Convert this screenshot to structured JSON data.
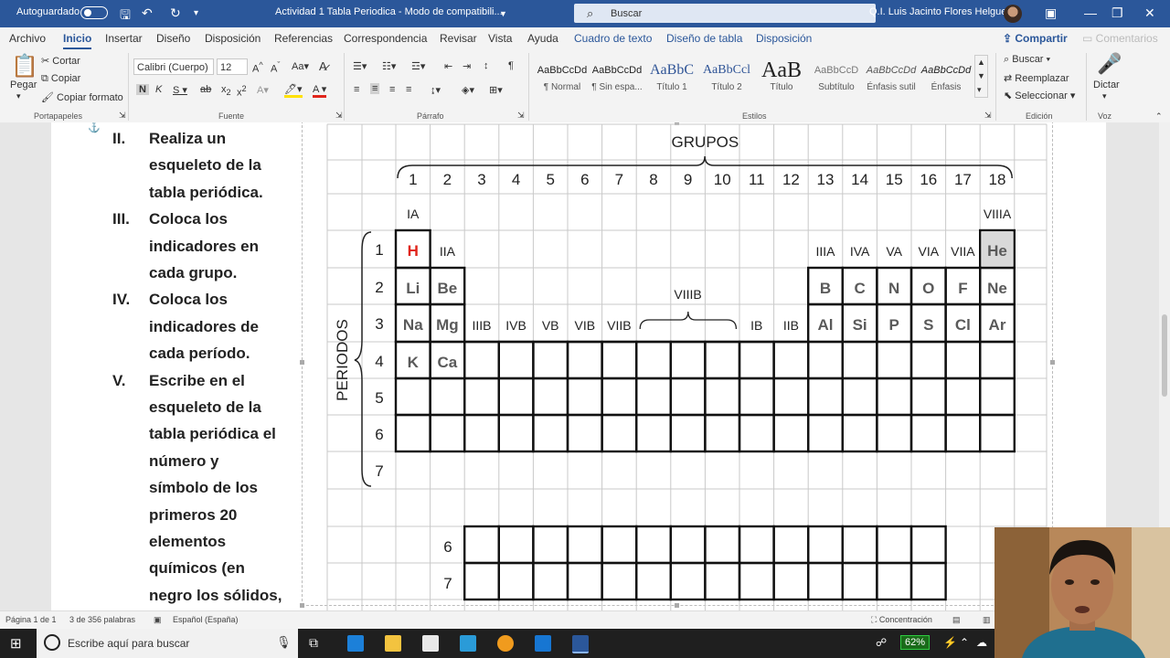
{
  "titlebar": {
    "autosave": "Autoguardado",
    "doc_title": "Actividad 1 Tabla Periodica  -  Modo de compatibili...",
    "search_placeholder": "Buscar",
    "user": "Q.I. Luis Jacinto Flores Helguera"
  },
  "tabs": [
    "Archivo",
    "Inicio",
    "Insertar",
    "Diseño",
    "Disposición",
    "Referencias",
    "Correspondencia",
    "Revisar",
    "Vista",
    "Ayuda",
    "Cuadro de texto",
    "Diseño de tabla",
    "Disposición"
  ],
  "share": {
    "label": "Compartir",
    "comments": "Comentarios"
  },
  "ribbon": {
    "clipboard": {
      "paste": "Pegar",
      "cut": "Cortar",
      "copy": "Copiar",
      "format_painter": "Copiar formato",
      "label": "Portapapeles"
    },
    "font": {
      "name": "Calibri (Cuerpo)",
      "size": "12",
      "label": "Fuente"
    },
    "paragraph": {
      "label": "Párrafo"
    },
    "styles": {
      "label": "Estilos",
      "items": [
        {
          "preview": "AaBbCcDd",
          "name": "¶ Normal"
        },
        {
          "preview": "AaBbCcDd",
          "name": "¶ Sin espa..."
        },
        {
          "preview": "AaBbC",
          "name": "Título 1"
        },
        {
          "preview": "AaBbCcl",
          "name": "Título 2"
        },
        {
          "preview": "AaB",
          "name": "Título"
        },
        {
          "preview": "AaBbCcD",
          "name": "Subtítulo"
        },
        {
          "preview": "AaBbCcDd",
          "name": "Énfasis sutil"
        },
        {
          "preview": "AaBbCcDd",
          "name": "Énfasis"
        }
      ]
    },
    "editing": {
      "find": "Buscar",
      "replace": "Reemplazar",
      "select": "Seleccionar",
      "label": "Edición"
    },
    "voice": {
      "dictate": "Dictar",
      "label": "Voz"
    }
  },
  "doc": {
    "list": [
      {
        "num": "II.",
        "lines": [
          "Realiza un",
          "esqueleto de la",
          "tabla periódica."
        ]
      },
      {
        "num": "III.",
        "lines": [
          "Coloca los",
          "indicadores en",
          "cada grupo."
        ]
      },
      {
        "num": "IV.",
        "lines": [
          "Coloca los",
          "indicadores de",
          "cada período."
        ]
      },
      {
        "num": "V.",
        "lines": [
          "Escribe en el",
          "esqueleto de la",
          "tabla periódica el",
          "número y",
          "símbolo de los",
          "primeros 20",
          "elementos",
          "químicos (en",
          "negro los sólidos,"
        ]
      }
    ],
    "table": {
      "grupos": "GRUPOS",
      "periodos": "PERIODOS",
      "group_numbers": [
        "1",
        "2",
        "3",
        "4",
        "5",
        "6",
        "7",
        "8",
        "9",
        "10",
        "11",
        "12",
        "13",
        "14",
        "15",
        "16",
        "17",
        "18"
      ],
      "ia": "IA",
      "viiia": "VIIIA",
      "row1_labels": [
        "IIA",
        "IIIA",
        "IVA",
        "VA",
        "VIA",
        "VIIA"
      ],
      "row3_labels": [
        "IIIB",
        "IVB",
        "VB",
        "VIB",
        "VIIB",
        "IB",
        "IIB"
      ],
      "viiib": "VIIIB",
      "period_numbers": [
        "1",
        "2",
        "3",
        "4",
        "5",
        "6",
        "7"
      ],
      "lower_period_numbers": [
        "6",
        "7"
      ],
      "elements": {
        "p1": [
          "H",
          "He"
        ],
        "p2": [
          "Li",
          "Be",
          "B",
          "C",
          "N",
          "O",
          "F",
          "Ne"
        ],
        "p3": [
          "Na",
          "Mg",
          "Al",
          "Si",
          "P",
          "S",
          "Cl",
          "Ar"
        ],
        "p4": [
          "K",
          "Ca"
        ]
      },
      "colors": {
        "hydrogen": "#e0251b",
        "element": "#5a5a5a",
        "helium_bg": "#d9d9d9"
      }
    }
  },
  "status": {
    "page": "Página 1 de 1",
    "words": "3 de 356 palabras",
    "language": "Español (España)",
    "focus": "Concentración"
  },
  "taskbar": {
    "search_placeholder": "Escribe aquí para buscar",
    "battery": "62%"
  }
}
